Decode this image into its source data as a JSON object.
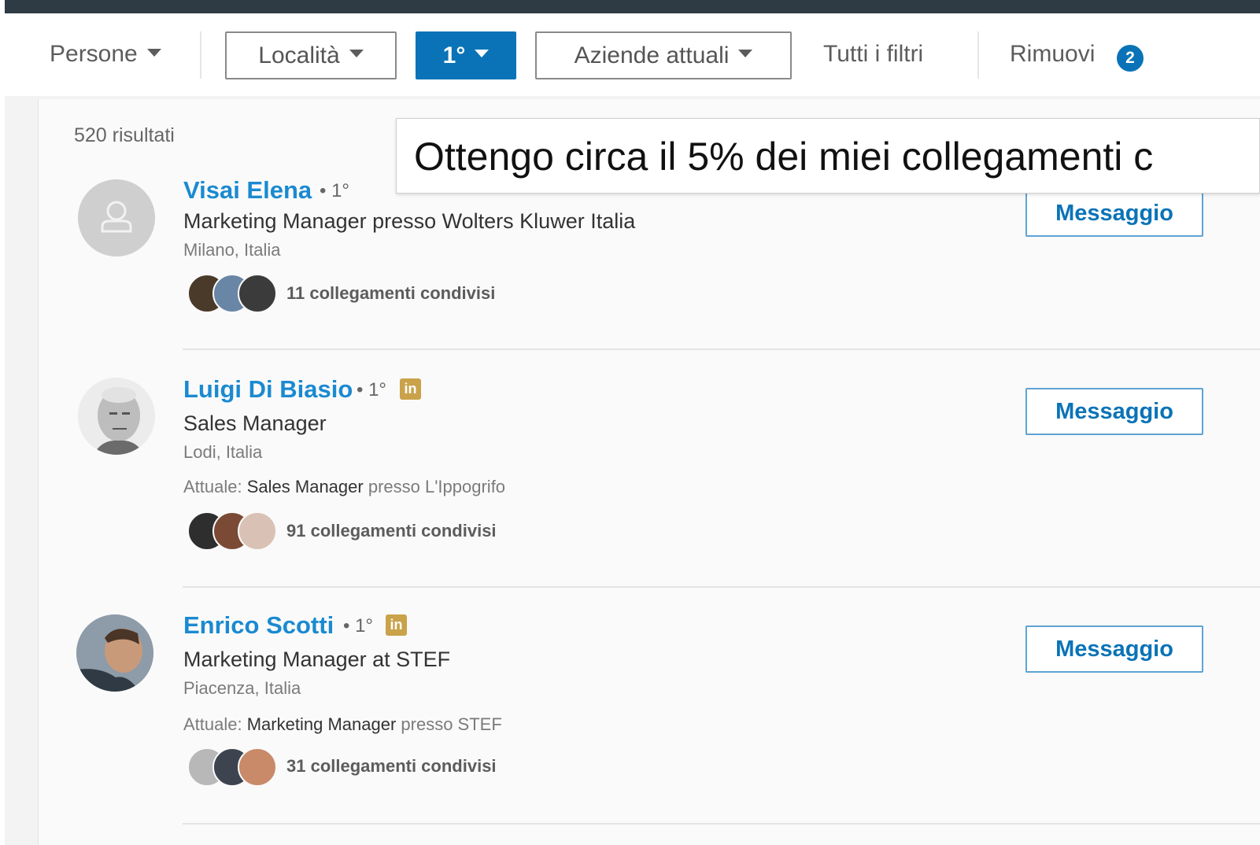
{
  "filters": {
    "people_label": "Persone",
    "location_label": "Località",
    "connections_label": "1°",
    "companies_label": "Aziende attuali",
    "all_filters_label": "Tutti i filtri",
    "remove_label": "Rimuovi",
    "remove_count": "2"
  },
  "results": {
    "count_label": "520 risultati",
    "items": [
      {
        "name": "Visai Elena",
        "degree": "• 1°",
        "headline": "Marketing Manager presso Wolters Kluwer Italia",
        "location": "Milano, Italia",
        "shared": "11 collegamenti condivisi",
        "message_label": "Messaggio"
      },
      {
        "name": "Luigi Di Biasio",
        "degree": "• 1°",
        "badge_icon": "in",
        "headline": "Sales Manager",
        "location": "Lodi, Italia",
        "current_prefix": "Attuale:",
        "current_role": "Sales Manager",
        "current_suffix": "presso L'Ippogrifo",
        "shared": "91 collegamenti condivisi",
        "message_label": "Messaggio"
      },
      {
        "name": "Enrico Scotti",
        "degree": "• 1°",
        "badge_icon": "in",
        "headline": "Marketing Manager at STEF",
        "location": "Piacenza, Italia",
        "current_prefix": "Attuale:",
        "current_role": "Marketing Manager",
        "current_suffix": "presso STEF",
        "shared": "31 collegamenti condivisi",
        "message_label": "Messaggio"
      }
    ]
  },
  "callout": {
    "text": "Ottengo circa il 5% dei miei collegamenti c"
  },
  "colors": {
    "accent": "#0a73b7",
    "link": "#1a8ad1",
    "premium_badge": "#c9a24a"
  }
}
